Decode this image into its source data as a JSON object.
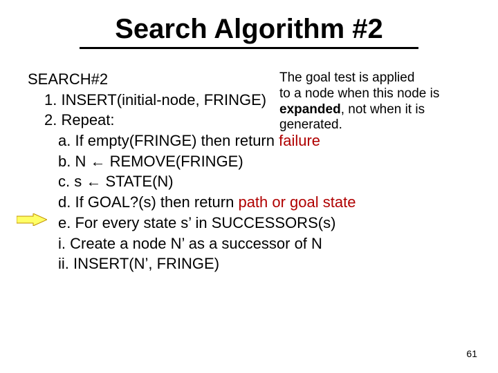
{
  "title": "Search Algorithm #2",
  "header": "SEARCH#2",
  "lines": {
    "l1": "1.  INSERT(initial-node, FRINGE)",
    "l2": "2. Repeat:",
    "a_pre": "a.  If empty(FRINGE) then return ",
    "a_fail": "failure",
    "b": "b.  N ← REMOVE(FRINGE)",
    "c": "c.  s ← STATE(N)",
    "d_pre": "d.  If GOAL?(s) then return ",
    "d_path": "path or goal state",
    "e": "e.  For every state s’ in SUCCESSORS(s)",
    "i": "i.  Create a node N’ as a successor of N",
    "ii": "ii. INSERT(N’, FRINGE)"
  },
  "callout": {
    "t1": "The goal test is applied",
    "t2": "to a node when this node is ",
    "t3_word": "expanded",
    "t3_rest": ", not when it is",
    "t4": "generated."
  },
  "page": "61"
}
